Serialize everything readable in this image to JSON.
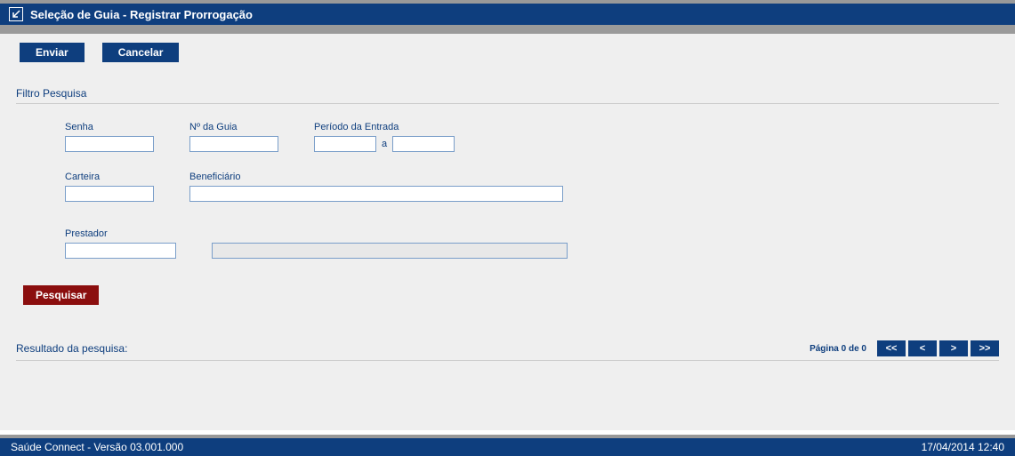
{
  "header": {
    "title": "Seleção de Guia - Registrar Prorrogação"
  },
  "toolbar": {
    "enviar": "Enviar",
    "cancelar": "Cancelar"
  },
  "filter": {
    "title": "Filtro Pesquisa",
    "senha_label": "Senha",
    "senha_value": "",
    "guia_label": "Nº da Guia",
    "guia_value": "",
    "periodo_label": "Período da Entrada",
    "periodo_from": "",
    "periodo_sep": "a",
    "periodo_to": "",
    "carteira_label": "Carteira",
    "carteira_value": "",
    "beneficiario_label": "Beneficiário",
    "beneficiario_value": "",
    "prestador_label": "Prestador",
    "prestador_code": "",
    "prestador_name": "",
    "pesquisar": "Pesquisar"
  },
  "results": {
    "title": "Resultado da pesquisa:",
    "page_info": "Página 0 de 0",
    "first": "<<",
    "prev": "<",
    "next": ">",
    "last": ">>"
  },
  "footer": {
    "left": "Saúde Connect - Versão 03.001.000",
    "right": "17/04/2014 12:40"
  }
}
